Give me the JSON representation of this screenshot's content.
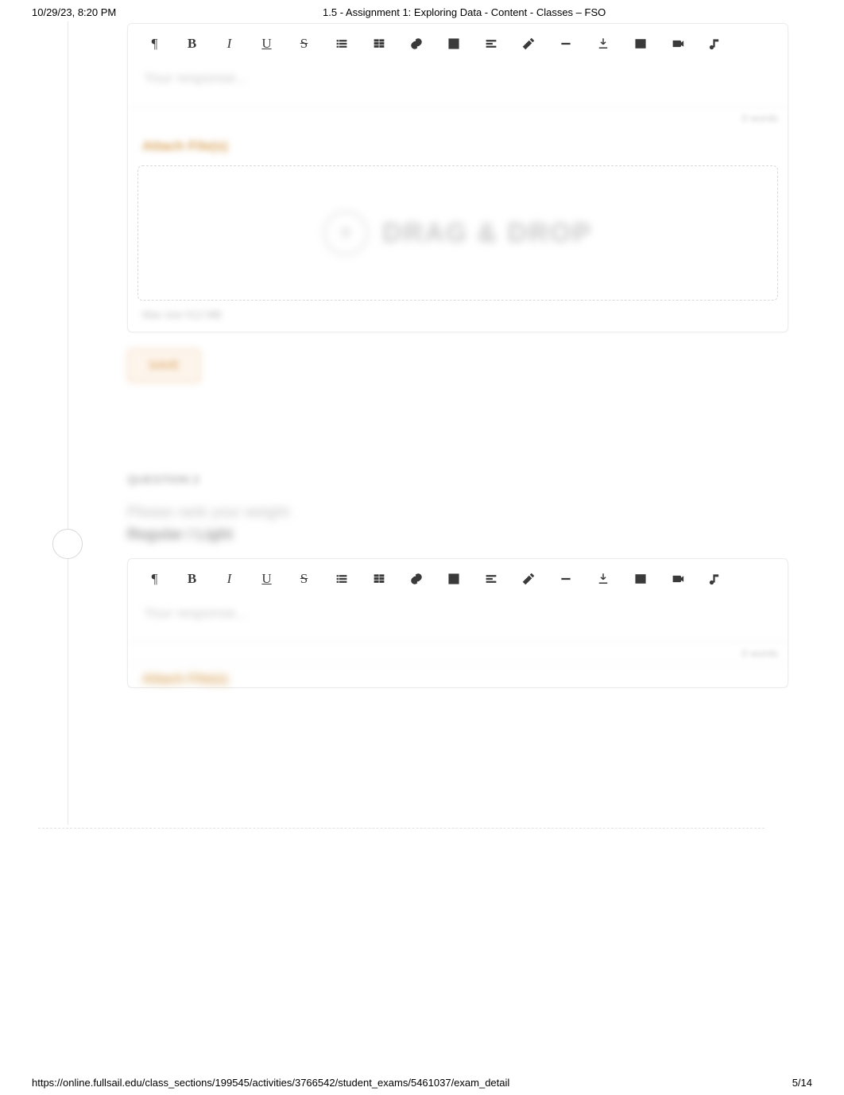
{
  "header": {
    "timestamp": "10/29/23, 8:20 PM",
    "title": "1.5 - Assignment 1: Exploring Data - Content - Classes – FSO"
  },
  "footer": {
    "url": "https://online.fullsail.edu/class_sections/199545/activities/3766542/student_exams/5461037/exam_detail",
    "page": "5/14"
  },
  "toolbar_icons": [
    "pilcrow-icon",
    "bold-icon",
    "italic-icon",
    "underline-icon",
    "strike-icon",
    "list-icon",
    "columns-icon",
    "link-icon",
    "table-icon",
    "align-icon",
    "highlight-icon",
    "minus-icon",
    "download-icon",
    "image-icon",
    "video-icon",
    "music-icon"
  ],
  "editor1": {
    "placeholder": "Your response...",
    "footer_text": "0 words"
  },
  "attach": {
    "header": "Attach File(s)",
    "drop_text": "DRAG & DROP",
    "limit_text": "Max size 512 MB"
  },
  "save_label": "SAVE",
  "question2": {
    "label": "QUESTION 2",
    "prompt": "Please rank your weight:",
    "sub": "Regular / Light"
  },
  "editor2": {
    "placeholder": "Your response...",
    "footer_text": "0 words"
  },
  "attach2_header": "Attach File(s)"
}
